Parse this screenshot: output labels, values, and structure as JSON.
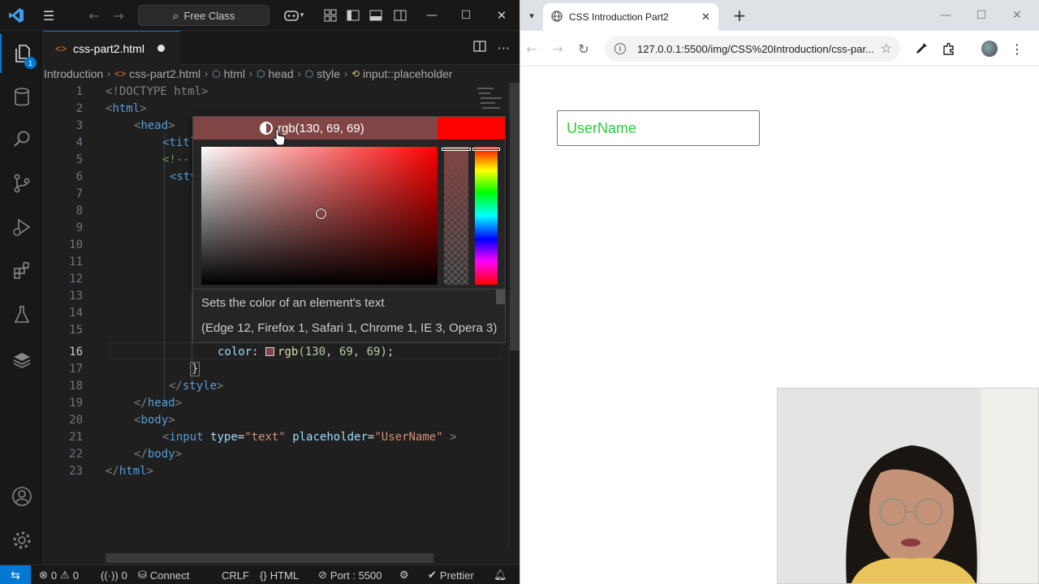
{
  "vscode": {
    "command_center": "Free Class",
    "tab": {
      "filename": "css-part2.html"
    },
    "breadcrumb": [
      "Introduction",
      "css-part2.html",
      "html",
      "head",
      "style",
      "input::placeholder"
    ],
    "lines": {
      "l1": "<!DOCTYPE html>",
      "l2": "html",
      "l3": "head",
      "l4": "<titl",
      "l5": "<!--",
      "l6": "<sty",
      "l16_prop": "color",
      "l16_fn": "rgb",
      "l16_args": "(130, 69, 69)",
      "l18": "style",
      "l19": "head",
      "l20": "body",
      "l21_tag": "input",
      "l21_attr1": "type",
      "l21_val1": "\"text\"",
      "l21_attr2": "placeholder",
      "l21_val2": "\"UserName\"",
      "l22": "body",
      "l23": "html"
    },
    "line_numbers": [
      "1",
      "2",
      "3",
      "4",
      "5",
      "6",
      "7",
      "8",
      "9",
      "10",
      "11",
      "12",
      "13",
      "14",
      "15",
      "16",
      "17",
      "18",
      "19",
      "20",
      "21",
      "22",
      "23"
    ],
    "color_picker": {
      "value": "rgb(130, 69, 69)",
      "current_color": "#824545",
      "original_color": "#ff0000"
    },
    "hover": {
      "description": "Sets the color of an element's text",
      "compat": "(Edge 12, Firefox 1, Safari 1, Chrome 1, IE 3, Opera 3)"
    },
    "status": {
      "errors": "0",
      "warnings": "0",
      "ports_count": "0",
      "connect": "Connect",
      "eol": "CRLF",
      "language": "HTML",
      "port": "Port : 5500",
      "prettier": "Prettier"
    },
    "explorer_badge": "1"
  },
  "browser": {
    "tab_title": "CSS Introduction Part2",
    "url": "127.0.0.1:5500/img/CSS%20Introduction/css-par...",
    "input_placeholder": "UserName",
    "placeholder_color": "#2ecc40"
  },
  "accent": "#0078d4"
}
